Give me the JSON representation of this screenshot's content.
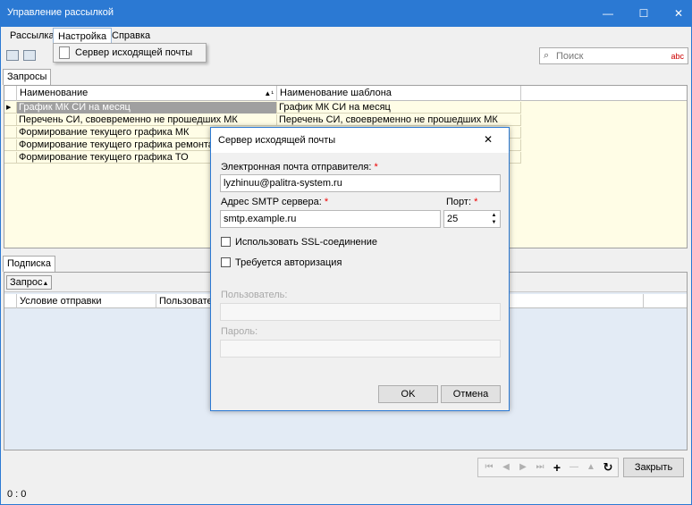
{
  "window": {
    "title": "Управление рассылкой",
    "minimize": "—",
    "maximize": "☐",
    "close": "✕"
  },
  "menu": {
    "items": [
      "Рассылка",
      "Настройка",
      "Справка"
    ],
    "dropdown_item": "Сервер исходящей почты"
  },
  "search": {
    "placeholder": "Поиск",
    "badge": "abc"
  },
  "top_tab": "Запросы",
  "grid1": {
    "columns": [
      "Наименование",
      "Наименование шаблона"
    ],
    "sort_marker": "▲¹",
    "rows": [
      [
        "График МК СИ на месяц",
        "График МК СИ на месяц"
      ],
      [
        "Перечень СИ, своевременно не прошедших МК",
        "Перечень СИ, своевременно не прошедших МК"
      ],
      [
        "Формирование текущего графика МК",
        ""
      ],
      [
        "Формирование текущего графика ремонта",
        ""
      ],
      [
        "Формирование текущего графика ТО",
        ""
      ]
    ]
  },
  "bottom_tab": "Подписка",
  "grid2": {
    "group_label": "Запрос",
    "group_marker": "▲",
    "columns": [
      "Условие отправки",
      "Пользовател"
    ]
  },
  "nav": {
    "first": "⏮",
    "prev": "◀",
    "next": "▶",
    "last": "⏭",
    "add": "+",
    "remove": "—",
    "up": "▲",
    "refresh": "↻",
    "close_label": "Закрыть"
  },
  "status": "0 : 0",
  "dialog": {
    "title": "Сервер исходящей почты",
    "close": "✕",
    "email_label": "Электронная почта отправителя:",
    "email_value": "lyzhinuu@palitra-system.ru",
    "smtp_label": "Адрес SMTP сервера:",
    "smtp_value": "smtp.example.ru",
    "port_label": "Порт:",
    "port_value": "25",
    "required": "*",
    "ssl_label": "Использовать SSL-соединение",
    "auth_label": "Требуется авторизация",
    "user_label": "Пользователь:",
    "pass_label": "Пароль:",
    "ok": "OK",
    "cancel": "Отмена"
  }
}
